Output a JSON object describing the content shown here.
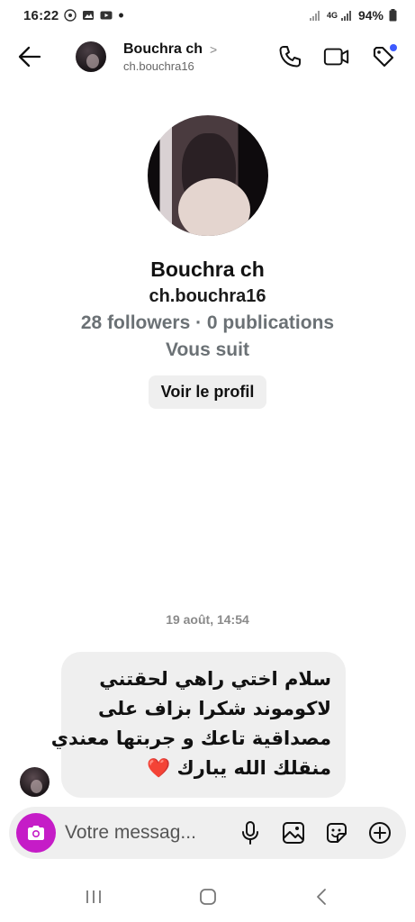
{
  "status": {
    "time": "16:22",
    "network": "4G",
    "battery": "94%"
  },
  "header": {
    "name": "Bouchra ch",
    "chevron": ">",
    "username": "ch.bouchra16"
  },
  "profile": {
    "name": "Bouchra ch",
    "username": "ch.bouchra16",
    "stats": "28 followers · 0 publications",
    "follows_status": "Vous suit",
    "view_profile_label": "Voir le profil"
  },
  "conversation": {
    "timestamp": "19 août, 14:54",
    "messages": [
      {
        "lines": [
          "سلام اختي راهي لحقتني",
          "لاكوموند  شكرا بزاف على",
          "مصداقية تاعك و جربتها معندي",
          "منقلك الله يبارك "
        ],
        "emoji": "❤️"
      }
    ]
  },
  "composer": {
    "placeholder": "Votre messag..."
  },
  "icons": {
    "back": "arrow-left-icon",
    "call": "phone-icon",
    "video": "video-camera-icon",
    "tag": "tag-icon",
    "camera": "camera-icon",
    "mic": "microphone-icon",
    "gallery": "image-icon",
    "sticker": "sticker-icon",
    "add": "plus-circle-icon"
  },
  "colors": {
    "accent": "#c51cc7",
    "notification": "#3d5afe",
    "heart": "#e0232f",
    "bubble": "#efefef"
  }
}
